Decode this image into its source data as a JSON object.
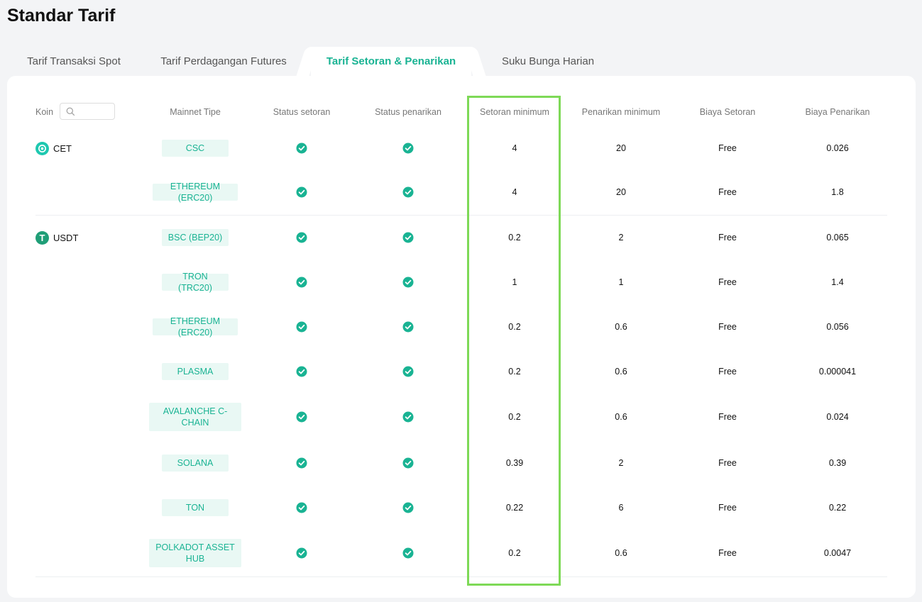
{
  "title": "Standar Tarif",
  "tabs": [
    {
      "label": "Tarif Transaksi Spot",
      "active": false
    },
    {
      "label": "Tarif Perdagangan Futures",
      "active": false
    },
    {
      "label": "Tarif Setoran & Penarikan",
      "active": true
    },
    {
      "label": "Suku Bunga Harian",
      "active": false
    }
  ],
  "search": {
    "placeholder": "",
    "value": ""
  },
  "headers": {
    "coin": "Koin",
    "network": "Mainnet Tipe",
    "deposit_status": "Status setoran",
    "withdraw_status": "Status penarikan",
    "min_deposit": "Setoran minimum",
    "min_withdraw": "Penarikan minimum",
    "deposit_fee": "Biaya Setoran",
    "withdraw_fee": "Biaya Penarikan"
  },
  "colors": {
    "accent": "#19b393",
    "highlight_border": "#7ed957",
    "cet_icon": "#1ec8b0",
    "usdt_icon": "#1f9e77"
  },
  "coins": [
    {
      "name": "CET",
      "icon": "cet-coin-icon",
      "rows": [
        {
          "network": "CSC",
          "deposit_ok": true,
          "withdraw_ok": true,
          "min_deposit": "4",
          "min_withdraw": "20",
          "deposit_fee": "Free",
          "withdraw_fee": "0.026"
        },
        {
          "network": "ETHEREUM (ERC20)",
          "deposit_ok": true,
          "withdraw_ok": true,
          "min_deposit": "4",
          "min_withdraw": "20",
          "deposit_fee": "Free",
          "withdraw_fee": "1.8"
        }
      ]
    },
    {
      "name": "USDT",
      "icon": "usdt-coin-icon",
      "rows": [
        {
          "network": "BSC (BEP20)",
          "deposit_ok": true,
          "withdraw_ok": true,
          "min_deposit": "0.2",
          "min_withdraw": "2",
          "deposit_fee": "Free",
          "withdraw_fee": "0.065"
        },
        {
          "network": "TRON (TRC20)",
          "deposit_ok": true,
          "withdraw_ok": true,
          "min_deposit": "1",
          "min_withdraw": "1",
          "deposit_fee": "Free",
          "withdraw_fee": "1.4"
        },
        {
          "network": "ETHEREUM (ERC20)",
          "deposit_ok": true,
          "withdraw_ok": true,
          "min_deposit": "0.2",
          "min_withdraw": "0.6",
          "deposit_fee": "Free",
          "withdraw_fee": "0.056"
        },
        {
          "network": "PLASMA",
          "deposit_ok": true,
          "withdraw_ok": true,
          "min_deposit": "0.2",
          "min_withdraw": "0.6",
          "deposit_fee": "Free",
          "withdraw_fee": "0.000041"
        },
        {
          "network": "AVALANCHE C-CHAIN",
          "deposit_ok": true,
          "withdraw_ok": true,
          "min_deposit": "0.2",
          "min_withdraw": "0.6",
          "deposit_fee": "Free",
          "withdraw_fee": "0.024"
        },
        {
          "network": "SOLANA",
          "deposit_ok": true,
          "withdraw_ok": true,
          "min_deposit": "0.39",
          "min_withdraw": "2",
          "deposit_fee": "Free",
          "withdraw_fee": "0.39"
        },
        {
          "network": "TON",
          "deposit_ok": true,
          "withdraw_ok": true,
          "min_deposit": "0.22",
          "min_withdraw": "6",
          "deposit_fee": "Free",
          "withdraw_fee": "0.22"
        },
        {
          "network": "POLKADOT ASSET HUB",
          "deposit_ok": true,
          "withdraw_ok": true,
          "min_deposit": "0.2",
          "min_withdraw": "0.6",
          "deposit_fee": "Free",
          "withdraw_fee": "0.0047"
        }
      ]
    }
  ]
}
